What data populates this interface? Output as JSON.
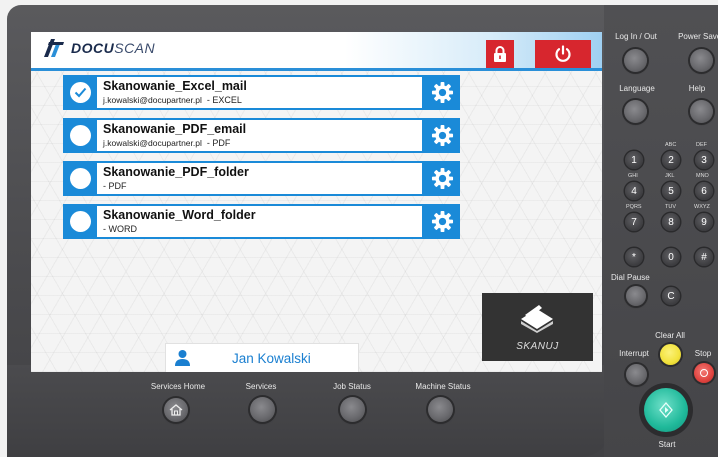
{
  "header": {
    "brand_bold": "DOCU",
    "brand_light": "SCAN"
  },
  "jobs": [
    {
      "name": "Skanowanie_Excel_mail",
      "email": "j.kowalski@docupartner.pl",
      "format": "- EXCEL",
      "selected": true
    },
    {
      "name": "Skanowanie_PDF_email",
      "email": "j.kowalski@docupartner.pl",
      "format": "- PDF",
      "selected": false
    },
    {
      "name": "Skanowanie_PDF_folder",
      "email": "",
      "format": "- PDF",
      "selected": false
    },
    {
      "name": "Skanowanie_Word_folder",
      "email": "",
      "format": "- WORD",
      "selected": false
    }
  ],
  "scan_button": {
    "label": "SKANUJ"
  },
  "user": {
    "name": "Jan Kowalski"
  },
  "bottom_buttons": [
    {
      "label": "Services Home"
    },
    {
      "label": "Services"
    },
    {
      "label": "Job Status"
    },
    {
      "label": "Machine Status"
    }
  ],
  "side": {
    "login": "Log In / Out",
    "power_saver": "Power Saver",
    "language": "Language",
    "help": "Help",
    "dial_pause": "Dial Pause",
    "clear_all": "Clear All",
    "interrupt": "Interrupt",
    "stop": "Stop",
    "start": "Start"
  },
  "keypad": [
    {
      "key": "1",
      "letters": ""
    },
    {
      "key": "2",
      "letters": "ABC"
    },
    {
      "key": "3",
      "letters": "DEF"
    },
    {
      "key": "4",
      "letters": "GHI"
    },
    {
      "key": "5",
      "letters": "JKL"
    },
    {
      "key": "6",
      "letters": "MNO"
    },
    {
      "key": "7",
      "letters": "PQRS"
    },
    {
      "key": "8",
      "letters": "TUV"
    },
    {
      "key": "9",
      "letters": "WXYZ"
    },
    {
      "key": "*",
      "letters": ""
    },
    {
      "key": "0",
      "letters": ""
    },
    {
      "key": "#",
      "letters": ""
    },
    {
      "key": "C",
      "letters": ""
    }
  ],
  "colors": {
    "accent": "#1a8ad8",
    "danger": "#d7262e",
    "start": "#1fb99a",
    "clear": "#f2e23c",
    "stop": "#e0433f"
  }
}
